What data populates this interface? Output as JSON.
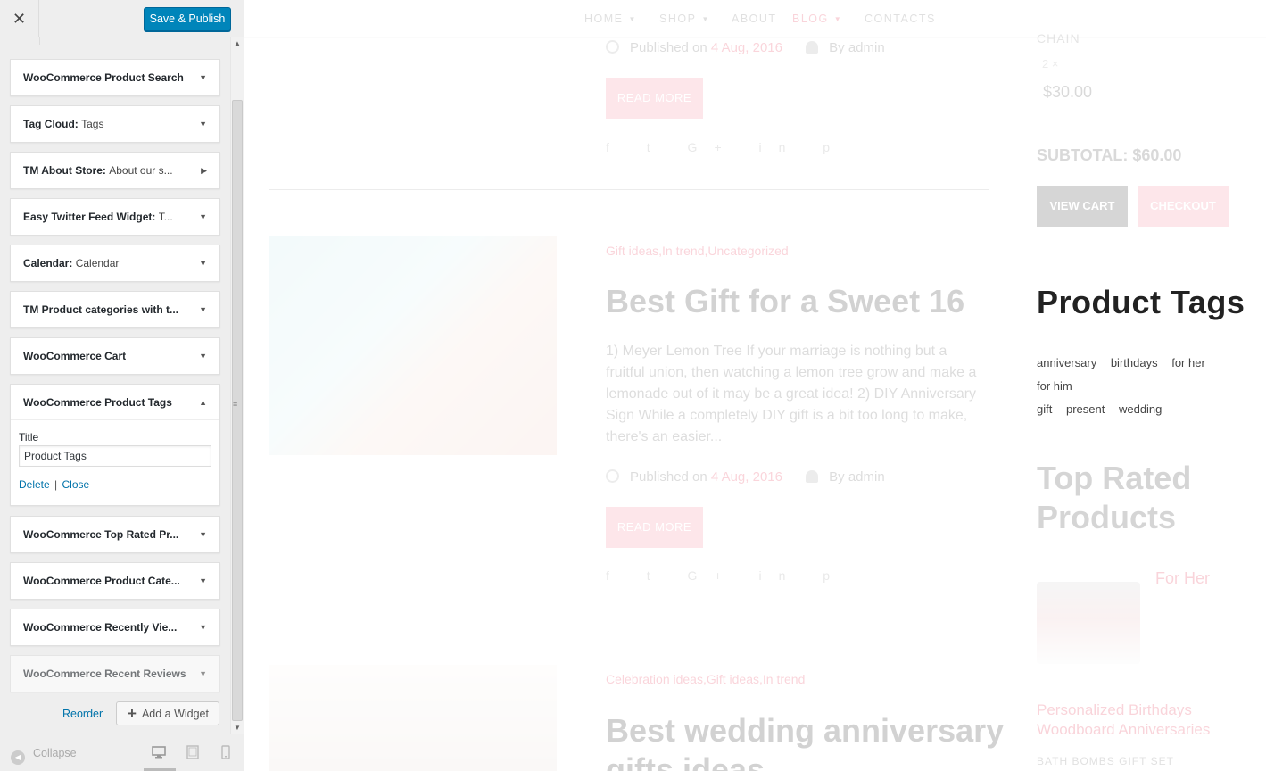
{
  "sidebar": {
    "close_glyph": "✕",
    "publish_label": "Save & Publish",
    "widgets": [
      {
        "title": "WooCommerce Product Search",
        "sub": "",
        "toggle": "▼"
      },
      {
        "title": "Tag Cloud",
        "sub": "Tags",
        "toggle": "▼"
      },
      {
        "title": "TM About Store",
        "sub": "About our s...",
        "toggle": "▶"
      },
      {
        "title": "Easy Twitter Feed Widget",
        "sub": "T...",
        "toggle": "▼"
      },
      {
        "title": "Calendar",
        "sub": "Calendar",
        "toggle": "▼"
      },
      {
        "title": "TM Product categories with t...",
        "sub": "",
        "toggle": "▼"
      },
      {
        "title": "WooCommerce Cart",
        "sub": "",
        "toggle": "▼"
      },
      {
        "title": "WooCommerce Product Tags",
        "sub": "",
        "toggle": "▲"
      },
      {
        "title": "WooCommerce Top Rated Pr...",
        "sub": "",
        "toggle": "▼"
      },
      {
        "title": "WooCommerce Product Cate...",
        "sub": "",
        "toggle": "▼"
      },
      {
        "title": "WooCommerce Recently Vie...",
        "sub": "",
        "toggle": "▼"
      },
      {
        "title": "WooCommerce Recent Reviews",
        "sub": "",
        "toggle": "▼"
      }
    ],
    "open_widget": {
      "field_label": "Title",
      "field_value": "Product Tags",
      "delete_label": "Delete",
      "separator": "|",
      "close_label": "Close"
    },
    "reorder_label": "Reorder",
    "add_widget_label": "Add a Widget",
    "collapse_label": "Collapse"
  },
  "preview": {
    "nav": [
      {
        "label": "HOME",
        "has_caret": true
      },
      {
        "label": "SHOP",
        "has_caret": true
      },
      {
        "label": "ABOUT",
        "has_caret": false
      },
      {
        "label": "BLOG",
        "has_caret": true
      },
      {
        "label": "CONTACTS",
        "has_caret": false
      }
    ],
    "post1": {
      "published_prefix": "Published on",
      "date": "4 Aug, 2016",
      "author": "By admin",
      "read_more": "READ MORE",
      "share": "f t G+ in p"
    },
    "post2": {
      "categories": "Gift ideas,In trend,Uncategorized",
      "title": "Best Gift for a Sweet 16",
      "excerpt": "1) Meyer Lemon Tree If your marriage is nothing but a fruitful union, then watching a lemon tree grow and make a lemonade out of it may be a great idea! 2) DIY Anniversary Sign While a completely DIY gift is a bit too long to make, there's an easier...",
      "published_prefix": "Published on",
      "date": "4 Aug, 2016",
      "author": "By admin",
      "read_more": "READ MORE",
      "share": "f t G+ in p"
    },
    "post3": {
      "categories": "Celebration ideas,Gift ideas,In trend",
      "title": "Best wedding anniversary gifts ideas"
    },
    "cart": {
      "chain": "CHAIN",
      "qty": "2 ×",
      "price": "$30.00",
      "subtotal": "SUBTOTAL: $60.00",
      "view_cart": "VIEW CART",
      "checkout": "CHECKOUT"
    },
    "product_tags": {
      "heading": "Product Tags",
      "tags": [
        "anniversary",
        "birthdays",
        "for her",
        "for him",
        "gift",
        "present",
        "wedding"
      ]
    },
    "top_rated": {
      "heading": "Top Rated Products",
      "category": "For Her",
      "product_name": "Personalized Birthdays Woodboard Anniversaries",
      "product_sub": "BATH BOMBS GIFT SET"
    }
  }
}
